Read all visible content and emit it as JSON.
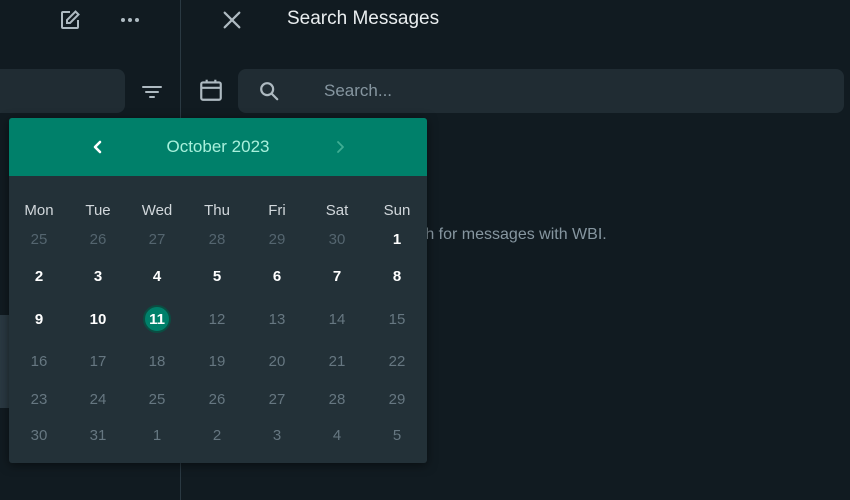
{
  "left": {
    "edit_icon": "edit-icon",
    "more_icon": "more-horizontal-icon",
    "filter_icon": "filter-icon"
  },
  "search_panel": {
    "title": "Search Messages",
    "placeholder": "Search...",
    "hint": "rch for messages with WBI.",
    "close_icon": "close-icon",
    "calendar_icon": "calendar-icon",
    "search_icon": "search-icon"
  },
  "calendar": {
    "month_label": "October 2023",
    "prev_label": "‹",
    "next_label": "›",
    "weekdays": [
      "Mon",
      "Tue",
      "Wed",
      "Thu",
      "Fri",
      "Sat",
      "Sun"
    ],
    "weeks": [
      [
        {
          "d": "25",
          "s": "outside"
        },
        {
          "d": "26",
          "s": "outside"
        },
        {
          "d": "27",
          "s": "outside"
        },
        {
          "d": "28",
          "s": "outside"
        },
        {
          "d": "29",
          "s": "outside"
        },
        {
          "d": "30",
          "s": "outside"
        },
        {
          "d": "1",
          "s": "current"
        }
      ],
      [
        {
          "d": "2",
          "s": "current"
        },
        {
          "d": "3",
          "s": "current"
        },
        {
          "d": "4",
          "s": "current"
        },
        {
          "d": "5",
          "s": "current"
        },
        {
          "d": "6",
          "s": "current"
        },
        {
          "d": "7",
          "s": "current"
        },
        {
          "d": "8",
          "s": "current"
        }
      ],
      [
        {
          "d": "9",
          "s": "current"
        },
        {
          "d": "10",
          "s": "current"
        },
        {
          "d": "11",
          "s": "selected"
        },
        {
          "d": "12",
          "s": "future"
        },
        {
          "d": "13",
          "s": "future"
        },
        {
          "d": "14",
          "s": "future"
        },
        {
          "d": "15",
          "s": "future"
        }
      ],
      [
        {
          "d": "16",
          "s": "future"
        },
        {
          "d": "17",
          "s": "future"
        },
        {
          "d": "18",
          "s": "future"
        },
        {
          "d": "19",
          "s": "future"
        },
        {
          "d": "20",
          "s": "future"
        },
        {
          "d": "21",
          "s": "future"
        },
        {
          "d": "22",
          "s": "future"
        }
      ],
      [
        {
          "d": "23",
          "s": "future"
        },
        {
          "d": "24",
          "s": "future"
        },
        {
          "d": "25",
          "s": "future"
        },
        {
          "d": "26",
          "s": "future"
        },
        {
          "d": "27",
          "s": "future"
        },
        {
          "d": "28",
          "s": "future"
        },
        {
          "d": "29",
          "s": "future"
        }
      ],
      [
        {
          "d": "30",
          "s": "future"
        },
        {
          "d": "31",
          "s": "future"
        },
        {
          "d": "1",
          "s": "future"
        },
        {
          "d": "2",
          "s": "future"
        },
        {
          "d": "3",
          "s": "future"
        },
        {
          "d": "4",
          "s": "future"
        },
        {
          "d": "5",
          "s": "future"
        }
      ]
    ]
  },
  "colors": {
    "background": "#111b21",
    "panel": "#202c33",
    "accent": "#00806a",
    "accent_text": "#a8f0dc"
  }
}
